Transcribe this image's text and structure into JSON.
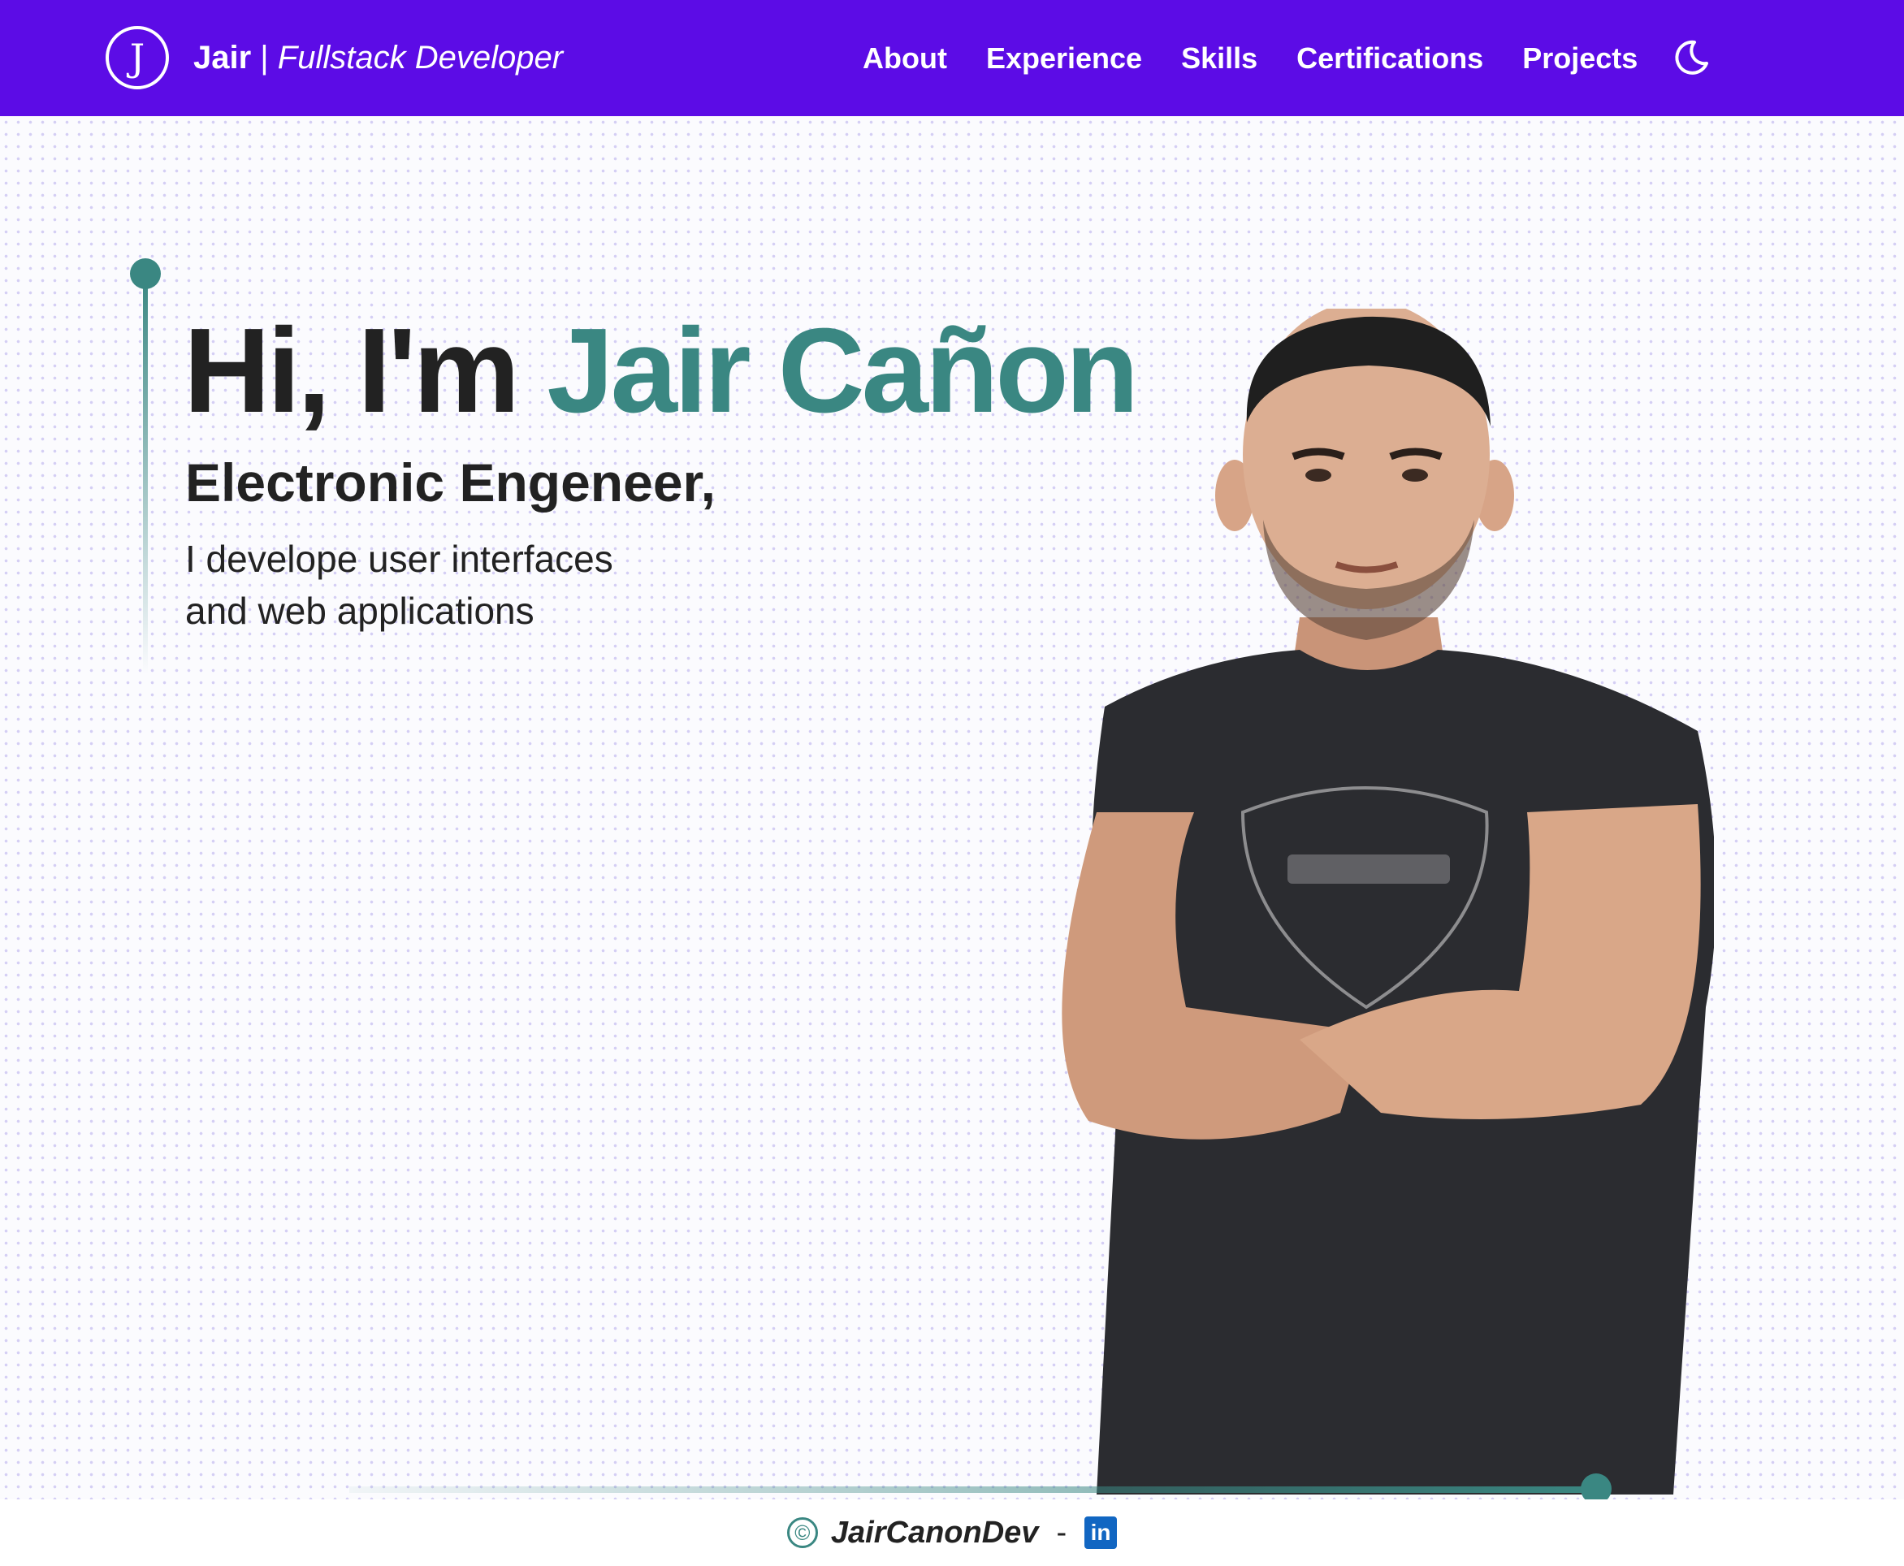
{
  "navbar": {
    "logo_letter": "J",
    "brand_name": "Jair",
    "brand_separator": " | ",
    "brand_role": "Fullstack Developer",
    "links": [
      "About",
      "Experience",
      "Skills",
      "Certifications",
      "Projects"
    ],
    "theme_icon": "moon-icon"
  },
  "hero": {
    "greeting": "Hi, I'm ",
    "name": "Jair Cañon",
    "subtitle": "Electronic Engeneer,",
    "description_line1": "I develope user interfaces",
    "description_line2": "and web applications"
  },
  "footer": {
    "copyright_symbol": "©",
    "handle": "JairCanonDev",
    "separator": "-",
    "linkedin_text": "in"
  },
  "colors": {
    "navbar_bg": "#5c0ce6",
    "accent": "#3a8782",
    "text": "#222222",
    "linkedin": "#1166c2"
  }
}
